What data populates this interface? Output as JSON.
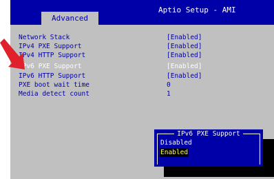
{
  "app": {
    "title": "Aptio Setup - AMI"
  },
  "tabs": [
    {
      "label": "Advanced"
    }
  ],
  "settings": [
    {
      "label": "Network Stack",
      "value": "[Enabled]"
    },
    {
      "label": "IPv4 PXE Support",
      "value": "[Enabled]"
    },
    {
      "label": "IPv4 HTTP Support",
      "value": "[Enabled]"
    },
    {
      "label": "IPv6 PXE Support",
      "value": "[Enabled]"
    },
    {
      "label": "IPv6 HTTP Support",
      "value": "[Enabled]"
    },
    {
      "label": "PXE boot wait time",
      "value": "0"
    },
    {
      "label": "Media detect count",
      "value": "1"
    }
  ],
  "selected_setting": "IPv6 PXE Support",
  "popup": {
    "title": "IPv6 PXE Support",
    "options": [
      "Disabled",
      "Enabled"
    ],
    "selected": "Enabled"
  },
  "icons": {
    "pointer": "red-arrow-icon"
  },
  "colors": {
    "background": "#0000a8",
    "panel": "#c0c0c0",
    "highlight_text": "#ffff55",
    "pointer": "#e0202a"
  }
}
